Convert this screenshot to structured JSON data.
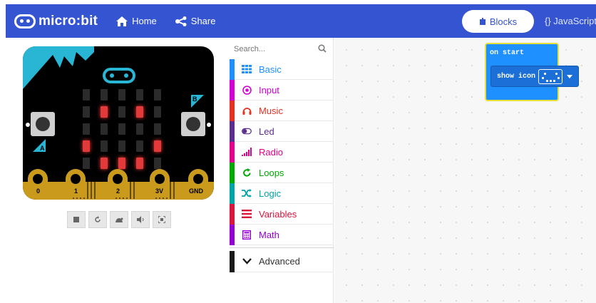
{
  "header": {
    "logo_text": "micro:bit",
    "home_label": "Home",
    "share_label": "Share",
    "tab_blocks_label": "Blocks",
    "tab_js_label": "{} JavaScript",
    "bg_color": "#3454d1"
  },
  "simulator": {
    "pin_labels": [
      "0",
      "1",
      "2",
      "3V",
      "GND"
    ],
    "button_a_label": "A",
    "button_b_label": "B",
    "led_matrix": [
      [
        0,
        0,
        0,
        0,
        0
      ],
      [
        0,
        1,
        0,
        1,
        0
      ],
      [
        0,
        0,
        0,
        0,
        0
      ],
      [
        1,
        0,
        0,
        0,
        1
      ],
      [
        0,
        1,
        1,
        1,
        0
      ]
    ],
    "tools": [
      "stop-icon",
      "restart-icon",
      "slowmo-icon",
      "mute-icon",
      "fullscreen-icon"
    ]
  },
  "toolbox": {
    "search_placeholder": "Search...",
    "categories": [
      {
        "label": "Basic",
        "color": "#1e90ff",
        "icon": "grid-icon"
      },
      {
        "label": "Input",
        "color": "#d400d4",
        "icon": "radio-target-icon"
      },
      {
        "label": "Music",
        "color": "#e63022",
        "icon": "headphones-icon"
      },
      {
        "label": "Led",
        "color": "#5c2d91",
        "icon": "toggle-icon"
      },
      {
        "label": "Radio",
        "color": "#e3008c",
        "icon": "signal-bars-icon"
      },
      {
        "label": "Loops",
        "color": "#00aa00",
        "icon": "refresh-icon"
      },
      {
        "label": "Logic",
        "color": "#00a4a6",
        "icon": "shuffle-icon"
      },
      {
        "label": "Variables",
        "color": "#dc143c",
        "icon": "list-lines-icon"
      },
      {
        "label": "Math",
        "color": "#9400d3",
        "icon": "calculator-icon"
      }
    ],
    "advanced": {
      "label": "Advanced",
      "color": "#1a1a1a",
      "icon": "chevron-down-icon"
    }
  },
  "workspace": {
    "on_start_label": "on start",
    "show_icon_label": "show icon",
    "block_color": "#1e90ff",
    "highlight_color": "#e7e03a"
  }
}
